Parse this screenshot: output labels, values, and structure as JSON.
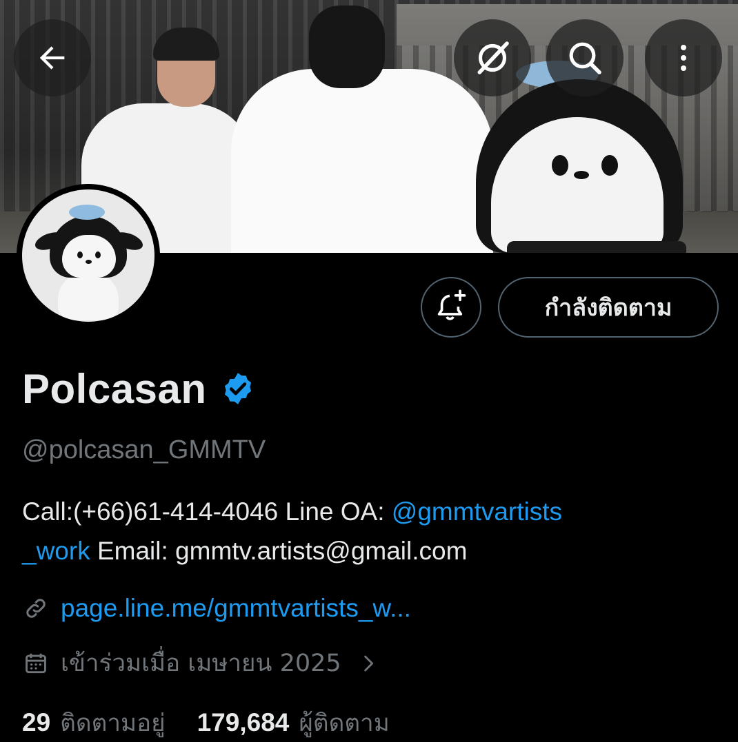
{
  "header": {
    "back_icon": "arrow-left-icon",
    "grok_icon": "grok-icon",
    "search_icon": "search-icon",
    "more_icon": "more-vertical-icon"
  },
  "profile": {
    "display_name": "Polcasan",
    "verified": true,
    "handle": "@polcasan_GMMTV",
    "bio": {
      "part1": "Call:(+66)61-414-4046 Line OA: ",
      "mention": "@gmmtvartists_work",
      "mention_line1": "@gmmtvartists",
      "mention_line2": "_work",
      "part2": " Email: gmmtv.artists@gmail.com"
    },
    "website": "page.line.me/gmmtvartists_w...",
    "joined": "เข้าร่วมเมื่อ เมษายน 2025",
    "following_count": "29",
    "following_label": "ติดตามอยู่",
    "followers_count": "179,684",
    "followers_label": "ผู้ติดตาม"
  },
  "actions": {
    "notify_icon": "bell-plus-icon",
    "following_button_label": "กำลังติดตาม"
  },
  "colors": {
    "background": "#000000",
    "text_primary": "#e7e9ea",
    "text_secondary": "#71767b",
    "link": "#1d9bf0",
    "verified_badge": "#1d9bf0",
    "button_border": "#536471"
  }
}
